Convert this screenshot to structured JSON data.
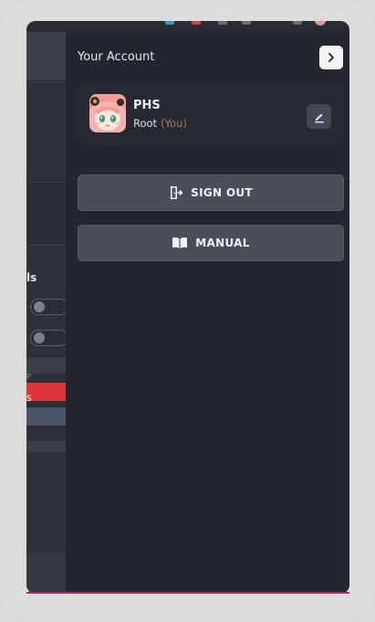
{
  "drawer": {
    "title": "Your Account",
    "close_icon": "chevron-right-icon"
  },
  "user": {
    "name": "PHS",
    "role": "Root",
    "you_label": "(You)",
    "avatar_icon": "anime-avatar",
    "edit_icon": "pencil-icon"
  },
  "actions": {
    "sign_out_label": "SIGN OUT",
    "sign_out_icon": "door-exit-icon",
    "manual_label": "MANUAL",
    "manual_icon": "open-book-icon"
  },
  "background_app": {
    "section_label_fragment": "ls",
    "small_label_fragment": "P",
    "red_label_fragment": "S"
  },
  "colors": {
    "drawer_bg": "#24262e",
    "button_bg": "#4b4e57",
    "you_accent": "#a77d55",
    "danger": "#e0353b",
    "edit_button_bg": "#434759"
  }
}
